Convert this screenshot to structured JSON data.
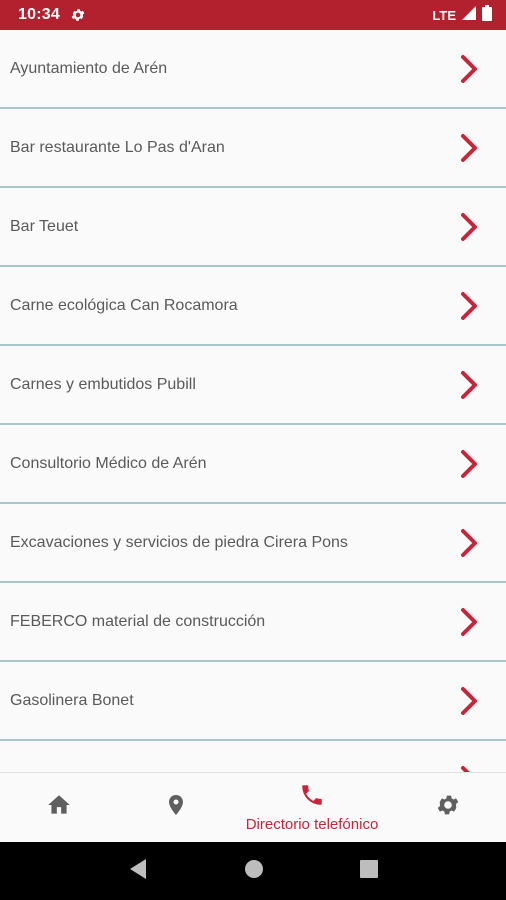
{
  "status_bar": {
    "time": "10:34",
    "network": "LTE",
    "background_color": "#b3202e",
    "icons": [
      "settings-icon",
      "signal-icon",
      "battery-icon"
    ]
  },
  "list": {
    "accent_color": "#c8243a",
    "divider_color": "#a9c6c9",
    "items": [
      {
        "label": "Ayuntamiento de Arén"
      },
      {
        "label": "Bar restaurante Lo Pas d'Aran"
      },
      {
        "label": "Bar Teuet"
      },
      {
        "label": "Carne ecológica Can Rocamora"
      },
      {
        "label": "Carnes y embutidos Pubill"
      },
      {
        "label": "Consultorio Médico de Arén"
      },
      {
        "label": "Excavaciones y servicios de piedra Cirera Pons"
      },
      {
        "label": "FEBERCO material de construcción"
      },
      {
        "label": "Gasolinera Bonet"
      },
      {
        "label": ""
      }
    ]
  },
  "bottom_nav": {
    "items": [
      {
        "icon": "home-icon",
        "label": "",
        "active": false
      },
      {
        "icon": "location-pin-icon",
        "label": "",
        "active": false
      },
      {
        "icon": "phone-icon",
        "label": "Directorio telefónico",
        "active": true
      },
      {
        "icon": "gear-icon",
        "label": "",
        "active": false
      }
    ],
    "active_color": "#c8243a",
    "inactive_color": "#5f5f5f"
  },
  "system_nav": {
    "icons": [
      "back-icon",
      "home-circle-icon",
      "recents-icon"
    ]
  }
}
